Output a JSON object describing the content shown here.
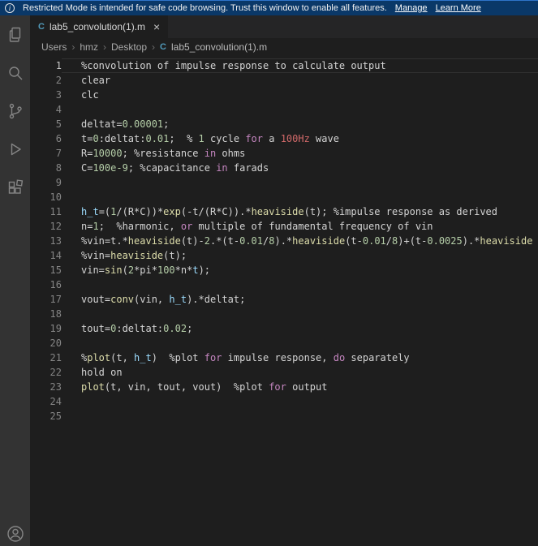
{
  "banner": {
    "text": "Restricted Mode is intended for safe code browsing. Trust this window to enable all features.",
    "manage_label": "Manage",
    "learn_more_label": "Learn More"
  },
  "tab": {
    "icon_letter": "C",
    "title": "lab5_convolution(1).m",
    "close_glyph": "×"
  },
  "breadcrumbs": {
    "items": [
      "Users",
      "hmz",
      "Desktop"
    ],
    "file": "lab5_convolution(1).m"
  },
  "activity_bar": {
    "items": [
      "files-icon",
      "search-icon",
      "source-control-icon",
      "run-and-debug-icon",
      "extensions-icon",
      "account-icon"
    ]
  },
  "ui_colors": {
    "banner_bg": "#0a3868",
    "banner_top_line": "#2e74c9",
    "activity_bar_bg": "#333333",
    "tabbar_bg": "#252526",
    "editor_bg": "#1e1e1e",
    "c_file_icon": "#519aba",
    "line_number": "#858585"
  },
  "editor": {
    "active_line": 1,
    "colors": {
      "plain": "#d4d4d4",
      "num": "#b5cea8",
      "fn": "#dcdcaa",
      "kw": "#c586c0",
      "var": "#9cdcfe",
      "bad": "#d16969"
    },
    "lines": [
      {
        "n": 1,
        "segs": [
          [
            "%convolution of impulse response to calculate output",
            "plain"
          ]
        ]
      },
      {
        "n": 2,
        "segs": [
          [
            "clear",
            "plain"
          ]
        ]
      },
      {
        "n": 3,
        "segs": [
          [
            "clc",
            "plain"
          ]
        ]
      },
      {
        "n": 4,
        "segs": []
      },
      {
        "n": 5,
        "segs": [
          [
            "deltat=",
            "plain"
          ],
          [
            "0.00001",
            "num"
          ],
          [
            ";",
            "plain"
          ]
        ]
      },
      {
        "n": 6,
        "segs": [
          [
            "t=",
            "plain"
          ],
          [
            "0",
            "num"
          ],
          [
            ":deltat:",
            "plain"
          ],
          [
            "0.01",
            "num"
          ],
          [
            ";  % ",
            "plain"
          ],
          [
            "1",
            "num"
          ],
          [
            " cycle ",
            "plain"
          ],
          [
            "for",
            "kw"
          ],
          [
            " a ",
            "plain"
          ],
          [
            "100Hz",
            "bad"
          ],
          [
            " wave",
            "plain"
          ]
        ]
      },
      {
        "n": 7,
        "segs": [
          [
            "R=",
            "plain"
          ],
          [
            "10000",
            "num"
          ],
          [
            "; %resistance ",
            "plain"
          ],
          [
            "in",
            "kw"
          ],
          [
            " ohms",
            "plain"
          ]
        ]
      },
      {
        "n": 8,
        "segs": [
          [
            "C=",
            "plain"
          ],
          [
            "100e-9",
            "num"
          ],
          [
            "; %capacitance ",
            "plain"
          ],
          [
            "in",
            "kw"
          ],
          [
            " farads",
            "plain"
          ]
        ]
      },
      {
        "n": 9,
        "segs": []
      },
      {
        "n": 10,
        "segs": []
      },
      {
        "n": 11,
        "segs": [
          [
            "h_t",
            "var"
          ],
          [
            "=(",
            "plain"
          ],
          [
            "1",
            "num"
          ],
          [
            "/(R*C))*",
            "plain"
          ],
          [
            "exp",
            "fn"
          ],
          [
            "(-t/(R*C)).*",
            "plain"
          ],
          [
            "heaviside",
            "fn"
          ],
          [
            "(t); %impulse response as derived",
            "plain"
          ]
        ]
      },
      {
        "n": 12,
        "segs": [
          [
            "n=",
            "plain"
          ],
          [
            "1",
            "num"
          ],
          [
            ";  %harmonic, ",
            "plain"
          ],
          [
            "or",
            "kw"
          ],
          [
            " multiple of fundamental frequency of vin",
            "plain"
          ]
        ]
      },
      {
        "n": 13,
        "segs": [
          [
            "%vin=t.*",
            "plain"
          ],
          [
            "heaviside",
            "fn"
          ],
          [
            "(t)-",
            "plain"
          ],
          [
            "2",
            "num"
          ],
          [
            ".*(t-",
            "plain"
          ],
          [
            "0.01",
            "num"
          ],
          [
            "/",
            "plain"
          ],
          [
            "8",
            "num"
          ],
          [
            ").*",
            "plain"
          ],
          [
            "heaviside",
            "fn"
          ],
          [
            "(t-",
            "plain"
          ],
          [
            "0.01",
            "num"
          ],
          [
            "/",
            "plain"
          ],
          [
            "8",
            "num"
          ],
          [
            ")+(t-",
            "plain"
          ],
          [
            "0.0025",
            "num"
          ],
          [
            ").*",
            "plain"
          ],
          [
            "heaviside",
            "fn"
          ]
        ]
      },
      {
        "n": 14,
        "segs": [
          [
            "%vin=",
            "plain"
          ],
          [
            "heaviside",
            "fn"
          ],
          [
            "(t);",
            "plain"
          ]
        ]
      },
      {
        "n": 15,
        "segs": [
          [
            "vin=",
            "plain"
          ],
          [
            "sin",
            "fn"
          ],
          [
            "(",
            "plain"
          ],
          [
            "2",
            "num"
          ],
          [
            "*pi*",
            "plain"
          ],
          [
            "100",
            "num"
          ],
          [
            "*n*",
            "plain"
          ],
          [
            "t",
            "var"
          ],
          [
            ");",
            "plain"
          ]
        ]
      },
      {
        "n": 16,
        "segs": []
      },
      {
        "n": 17,
        "segs": [
          [
            "vout=",
            "plain"
          ],
          [
            "conv",
            "fn"
          ],
          [
            "(vin, ",
            "plain"
          ],
          [
            "h_t",
            "var"
          ],
          [
            ").*deltat;",
            "plain"
          ]
        ]
      },
      {
        "n": 18,
        "segs": []
      },
      {
        "n": 19,
        "segs": [
          [
            "tout=",
            "plain"
          ],
          [
            "0",
            "num"
          ],
          [
            ":deltat:",
            "plain"
          ],
          [
            "0.02",
            "num"
          ],
          [
            ";",
            "plain"
          ]
        ]
      },
      {
        "n": 20,
        "segs": []
      },
      {
        "n": 21,
        "segs": [
          [
            "%",
            "plain"
          ],
          [
            "plot",
            "fn"
          ],
          [
            "(t, ",
            "plain"
          ],
          [
            "h_t",
            "var"
          ],
          [
            ")  %plot ",
            "plain"
          ],
          [
            "for",
            "kw"
          ],
          [
            " impulse response, ",
            "plain"
          ],
          [
            "do",
            "kw"
          ],
          [
            " separately",
            "plain"
          ]
        ]
      },
      {
        "n": 22,
        "segs": [
          [
            "hold on",
            "plain"
          ]
        ]
      },
      {
        "n": 23,
        "segs": [
          [
            "plot",
            "fn"
          ],
          [
            "(t, vin, tout, vout)  %plot ",
            "plain"
          ],
          [
            "for",
            "kw"
          ],
          [
            " output",
            "plain"
          ]
        ]
      },
      {
        "n": 24,
        "segs": []
      },
      {
        "n": 25,
        "segs": []
      }
    ]
  }
}
